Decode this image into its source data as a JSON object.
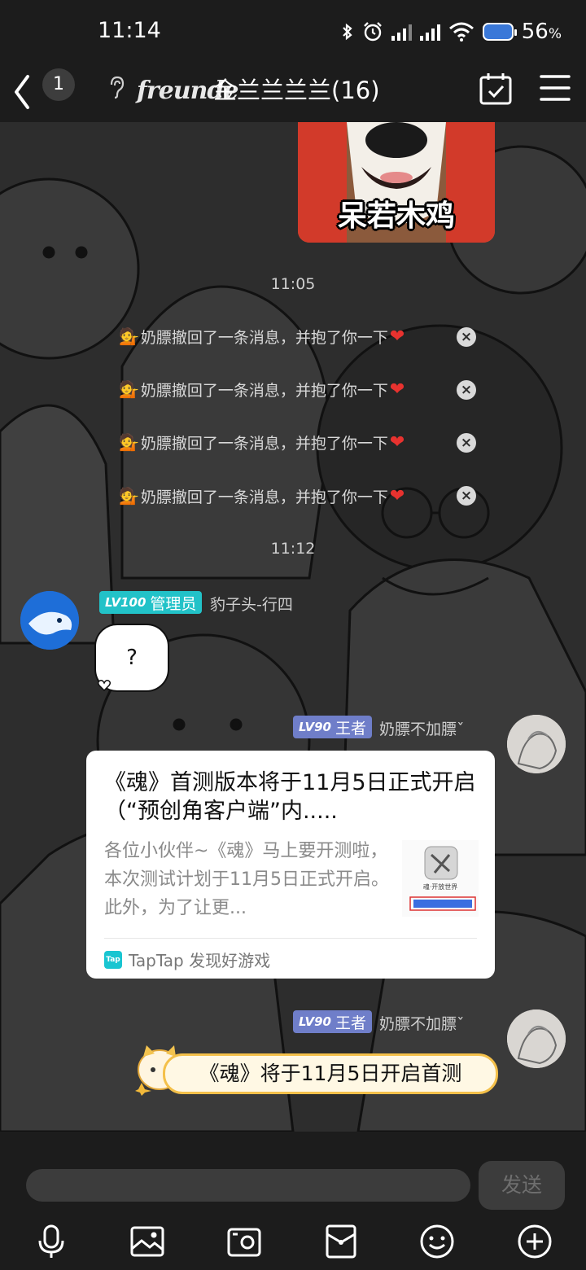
{
  "status_bar": {
    "time": "11:14",
    "battery_percent": "56",
    "battery_unit": "%"
  },
  "header": {
    "unread_count": "1",
    "logo_text": "freunde",
    "title": "金兰兰兰兰(16)"
  },
  "chat": {
    "sticker_caption": "呆若木鸡",
    "timestamps": [
      "11:05",
      "11:12"
    ],
    "recall_notices": [
      {
        "icon": "person-tipping-hand-emoji",
        "text": "奶膘撤回了一条消息，并抱了你一下",
        "heart": "❤"
      },
      {
        "icon": "person-tipping-hand-emoji",
        "text": "奶膘撤回了一条消息，并抱了你一下",
        "heart": "❤"
      },
      {
        "icon": "person-tipping-hand-emoji",
        "text": "奶膘撤回了一条消息，并抱了你一下",
        "heart": "❤"
      },
      {
        "icon": "person-tipping-hand-emoji",
        "text": "奶膘撤回了一条消息，并抱了你一下",
        "heart": "❤"
      }
    ],
    "messages": [
      {
        "side": "left",
        "level": "LV100",
        "role": "管理员",
        "badge_color": "#22c2c8",
        "sender": "豹子头-行四",
        "text": "?"
      },
      {
        "side": "right",
        "level": "LV90",
        "role": "王者",
        "badge_color": "#6f7ec9",
        "sender": "奶膘不加膘ˇ",
        "card": {
          "title": "《魂》首测版本将于11月5日正式开启（“预创角客户端”内.....",
          "description": "各位小伙伴~《魂》马上要开测啦，本次测试计划于11月5日正式开启。此外，为了让更...",
          "thumb_caption": "魂·开放世界",
          "source": "TapTap 发现好游戏",
          "source_icon_text": "Tap"
        }
      },
      {
        "side": "right",
        "level": "LV90",
        "role": "王者",
        "badge_color": "#6f7ec9",
        "sender": "奶膘不加膘ˇ",
        "text": "《魂》将于11月5日开启首测"
      }
    ]
  },
  "input_bar": {
    "placeholder": "",
    "send_label": "发送",
    "tools": [
      "microphone-icon",
      "image-icon",
      "camera-icon",
      "red-packet-icon",
      "emoji-icon",
      "plus-icon"
    ]
  },
  "colors": {
    "bar_background": "#1c1c1c",
    "chat_background": "#2d2d2d",
    "admin_badge": "#22c2c8",
    "king_badge": "#6f7ec9"
  }
}
